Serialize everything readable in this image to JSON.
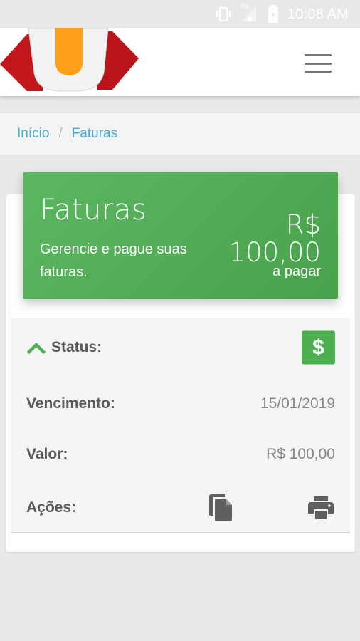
{
  "status_bar": {
    "time": "10:08 AM",
    "network": "4G"
  },
  "breadcrumb": {
    "items": [
      "Início",
      "Faturas"
    ],
    "separator": "/"
  },
  "hero": {
    "title": "Faturas",
    "description": "Gerencie e pague suas faturas.",
    "currency": "R$",
    "amount": "100,00",
    "amount_caption": "a pagar"
  },
  "details": {
    "status_label": "Status:",
    "due_label": "Vencimento:",
    "due_value": "15/01/2019",
    "amount_label": "Valor:",
    "amount_value": "R$ 100,00",
    "actions_label": "Ações:"
  },
  "icons": {
    "status_bar": [
      "vibrate-icon",
      "signal-icon",
      "battery-icon"
    ],
    "menu": "hamburger-menu-icon",
    "status_toggle": "chevron-up-icon",
    "status_badge": "dollar-icon",
    "actions": [
      "copy-icon",
      "print-icon"
    ]
  },
  "colors": {
    "accent_green": "#4caf50",
    "link_blue": "#40b1d4",
    "logo_red": "#c0161c",
    "logo_orange": "#ff9f1a"
  }
}
